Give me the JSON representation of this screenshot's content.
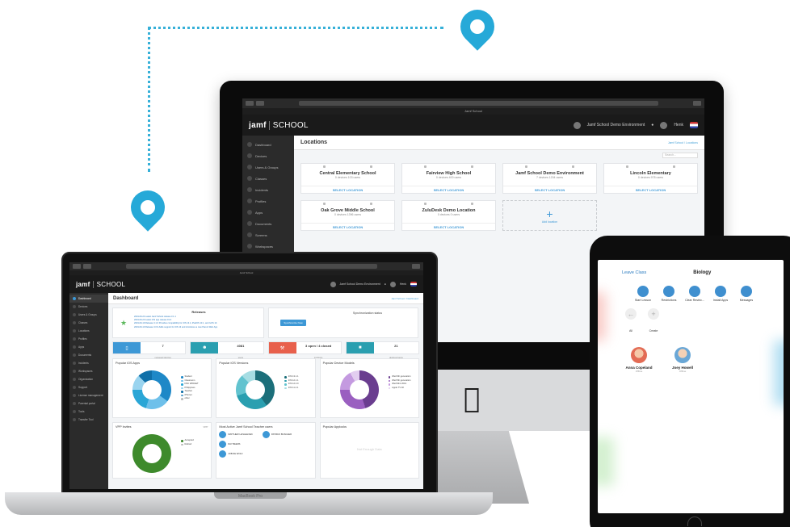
{
  "imac": {
    "tab_title": "Jamf School",
    "logo_main": "jamf",
    "logo_sub": "SCHOOL",
    "environment": "Jamf School Demo Environment",
    "user": "Henk",
    "sidebar": [
      "Dashboard",
      "Devices",
      "Users & Groups",
      "Classes",
      "Incidents",
      "Profiles",
      "Apps",
      "Documents",
      "Screens",
      "Workspaces"
    ],
    "page_title": "Locations",
    "breadcrumb": "Jamf School / Locations",
    "search_placeholder": "Search...",
    "select_label": "SELECT LOCATION",
    "add_label": "Add location",
    "locations": [
      {
        "name": "Central Elementary School",
        "stats": "0 devices  103 users"
      },
      {
        "name": "Fairview High School",
        "stats": "0 devices  400 users"
      },
      {
        "name": "Jamf School Demo Environment",
        "stats": "7 devices  1204 users"
      },
      {
        "name": "Lincoln Elementary",
        "stats": "0 devices  978 users"
      },
      {
        "name": "Oak Grove Middle School",
        "stats": "0 devices  1396 users"
      },
      {
        "name": "ZuluDesk Demo Location",
        "stats": "0 devices  0 users"
      }
    ]
  },
  "macbook": {
    "tab_title": "Jamf School",
    "logo_main": "jamf",
    "logo_sub": "SCHOOL",
    "environment": "Jamf School Demo Environment",
    "user": "Henk",
    "brand_label": "MacBook Pro",
    "sidebar": [
      "Dashboard",
      "Devices",
      "Users & Groups",
      "Classes",
      "Locations",
      "Profiles",
      "Apps",
      "Documents",
      "Incidents",
      "Workspaces",
      "Organization",
      "Support",
      "License management",
      "Parental portal",
      "Tools",
      "Transfer Tool"
    ],
    "page_title": "Dashboard",
    "breadcrumb": "Jamf School / Dashboard",
    "releases_title": "Releases",
    "releases": [
      "2019-09-24  Latest Jamf School release 3.1.1",
      "2019-09-20  Latest iOS app release 19.3",
      "2019-09-19  Release 3.1.0 Provides compatibility for iOS 13.1, iPadOS 13.1, and tvOS 13.",
      "2019-09-10  Release 3.0.9 Adds support for iOS 13 and introduces a new Parent Web App"
    ],
    "sync_button": "Synchronize Now",
    "sync_status": "Synchronization status",
    "stats": [
      {
        "value": "7",
        "label": "managed devices",
        "color": "#3d98d6"
      },
      {
        "value": "4081",
        "label": "users",
        "color": "#2a9fb0"
      },
      {
        "value": "3 open / 4 closed",
        "label": "incidents",
        "color": "#e8604c"
      },
      {
        "value": "21",
        "label": "deployed apps",
        "color": "#2a9fb0"
      }
    ],
    "panels": {
      "ios_apps": "Popular iOS Apps",
      "ios_versions": "Popular iOS Versions",
      "device_models": "Popular Device Models",
      "vpp": "VPP Invites",
      "vpp_link": "VPP",
      "teachers": "Most Active Jamf School Teacher users",
      "applocks": "Popular Applocks",
      "no_data": "Not Enough Data"
    },
    "ios_apps_legend": [
      "Student",
      "Classroom",
      "DSC WIDGET",
      "Philippines",
      "Teacher",
      "iPhoner",
      "other"
    ],
    "ios_versions_legend": [
      "iOS 13.1.1",
      "iOS 12.1.1",
      "iOS 12.2.0",
      "iOS 11.4.1"
    ],
    "device_models_legend": [
      "iPad 6th generation",
      "iPad 5th generation",
      "iPad Mini 2019",
      "Apple TV 4K"
    ],
    "vpp_legend": [
      "Accepted",
      "Retired"
    ],
    "teacher_list": [
      "MATTHEW HASLEHOEK",
      "PATRICK BUSCHER",
      "RAY BEERS",
      "JOB DE WOLF"
    ]
  },
  "ipad": {
    "leave_label": "Leave Class",
    "class_name": "Biology",
    "actions": [
      "Start Lesson",
      "Restrictions",
      "Clear Restric...",
      "Install Apps",
      "Messages"
    ],
    "filters": [
      {
        "icon": "←",
        "label": "All"
      },
      {
        "icon": "+",
        "label": "Create"
      }
    ],
    "students": [
      {
        "name": "Anna Copeland",
        "status": "Offline"
      },
      {
        "name": "Joey Howell",
        "status": "Offline"
      }
    ]
  }
}
